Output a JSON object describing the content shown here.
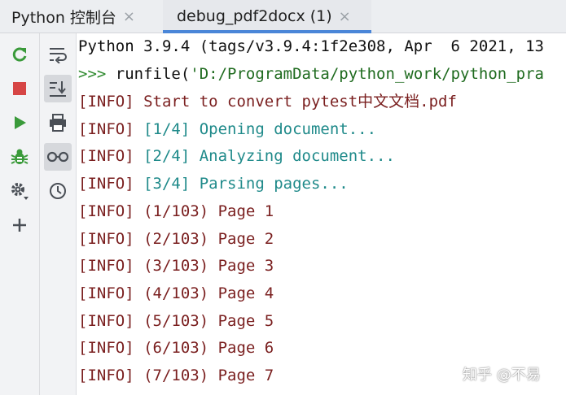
{
  "tabs": [
    {
      "label": "Python 控制台",
      "close": "×"
    },
    {
      "label": "debug_pdf2docx (1)",
      "close": "×"
    }
  ],
  "left_toolbar": {
    "buttons": [
      "rerun-icon",
      "stop-icon",
      "run-icon",
      "debug-bug-icon",
      "settings-gear-icon",
      "add-icon"
    ],
    "colors": {
      "green": "#3a9a3a",
      "red": "#d64545",
      "gray": "#4a4f56"
    }
  },
  "right_toolbar": {
    "buttons": [
      "soft-wrap-icon",
      "scroll-to-end-icon",
      "print-icon",
      "glasses-icon",
      "history-clock-icon"
    ]
  },
  "console": {
    "header": "Python 3.9.4 (tags/v3.9.4:1f2e308, Apr  6 2021, 13",
    "prompt": ">>> ",
    "runfile_call": "runfile(",
    "runfile_arg": "'D:/ProgramData/python_work/python_pra",
    "lines": [
      {
        "prefix": "[INFO] ",
        "text": "Start to convert pytest中文文档.pdf",
        "style": "dred"
      },
      {
        "prefix": "[INFO] ",
        "text": "[1/4] Opening document...",
        "style": "teal"
      },
      {
        "prefix": "[INFO] ",
        "text": "[2/4] Analyzing document...",
        "style": "teal"
      },
      {
        "prefix": "[INFO] ",
        "text": "[3/4] Parsing pages...",
        "style": "teal"
      },
      {
        "prefix": "[INFO] ",
        "text": "(1/103) Page 1",
        "style": "dred"
      },
      {
        "prefix": "[INFO] ",
        "text": "(2/103) Page 2",
        "style": "dred"
      },
      {
        "prefix": "[INFO] ",
        "text": "(3/103) Page 3",
        "style": "dred"
      },
      {
        "prefix": "[INFO] ",
        "text": "(4/103) Page 4",
        "style": "dred"
      },
      {
        "prefix": "[INFO] ",
        "text": "(5/103) Page 5",
        "style": "dred"
      },
      {
        "prefix": "[INFO] ",
        "text": "(6/103) Page 6",
        "style": "dred"
      },
      {
        "prefix": "[INFO] ",
        "text": "(7/103) Page 7",
        "style": "dred"
      }
    ]
  },
  "watermark": "知乎 @不易"
}
